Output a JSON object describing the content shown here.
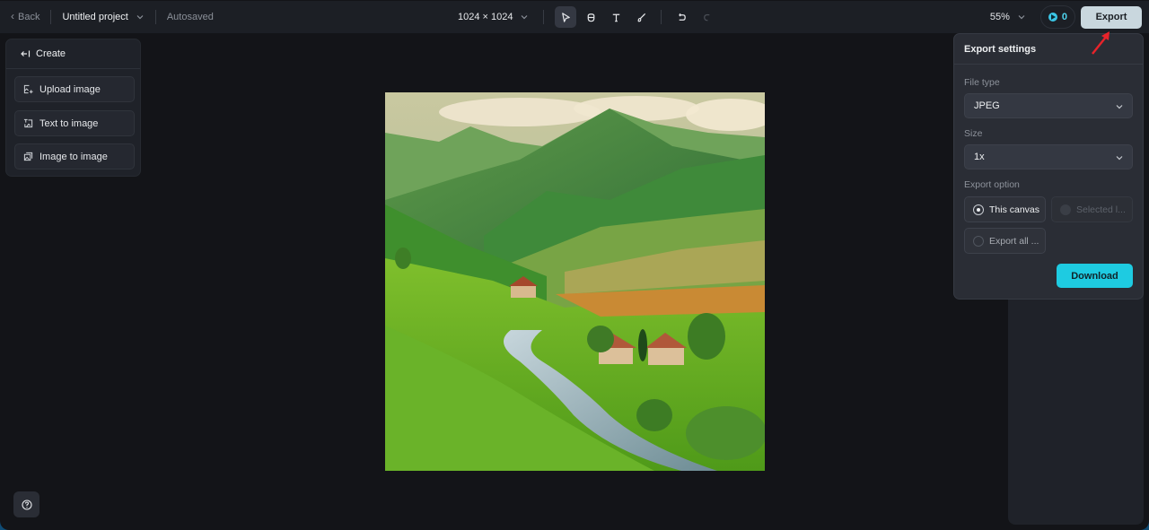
{
  "topbar": {
    "back_label": "Back",
    "project_name": "Untitled project",
    "save_status": "Autosaved",
    "canvas_size": "1024 × 1024",
    "tools": [
      {
        "name": "select-tool",
        "icon": "cursor-arrow-icon",
        "active": true
      },
      {
        "name": "hand-tool",
        "icon": "hand-icon",
        "active": false
      },
      {
        "name": "text-tool",
        "icon": "text-icon",
        "active": false
      },
      {
        "name": "brush-tool",
        "icon": "brush-icon",
        "active": false
      },
      {
        "name": "undo",
        "icon": "undo-icon",
        "active": false
      },
      {
        "name": "redo",
        "icon": "redo-icon",
        "active": false,
        "disabled": true
      }
    ],
    "zoom_level": "55%",
    "credits": "0",
    "export_label": "Export"
  },
  "left_panel": {
    "header": "Create",
    "items": [
      {
        "label": "Upload image",
        "icon": "upload-image-icon"
      },
      {
        "label": "Text to image",
        "icon": "text-to-image-icon"
      },
      {
        "label": "Image to image",
        "icon": "image-to-image-icon"
      }
    ]
  },
  "canvas": {
    "image_description": "Green rolling hills valley with river and farmhouses"
  },
  "export_settings": {
    "title": "Export settings",
    "file_type_label": "File type",
    "file_type_value": "JPEG",
    "size_label": "Size",
    "size_value": "1x",
    "export_option_label": "Export option",
    "options": [
      {
        "label": "This canvas",
        "selected": true,
        "disabled": false
      },
      {
        "label": "Selected l...",
        "selected": false,
        "disabled": true
      },
      {
        "label": "Export all ...",
        "selected": false,
        "disabled": false
      }
    ],
    "download_label": "Download"
  },
  "colors": {
    "accent": "#1ecbe1",
    "export_button": "#c9d7de",
    "annotation_arrow": "#e8232a"
  }
}
